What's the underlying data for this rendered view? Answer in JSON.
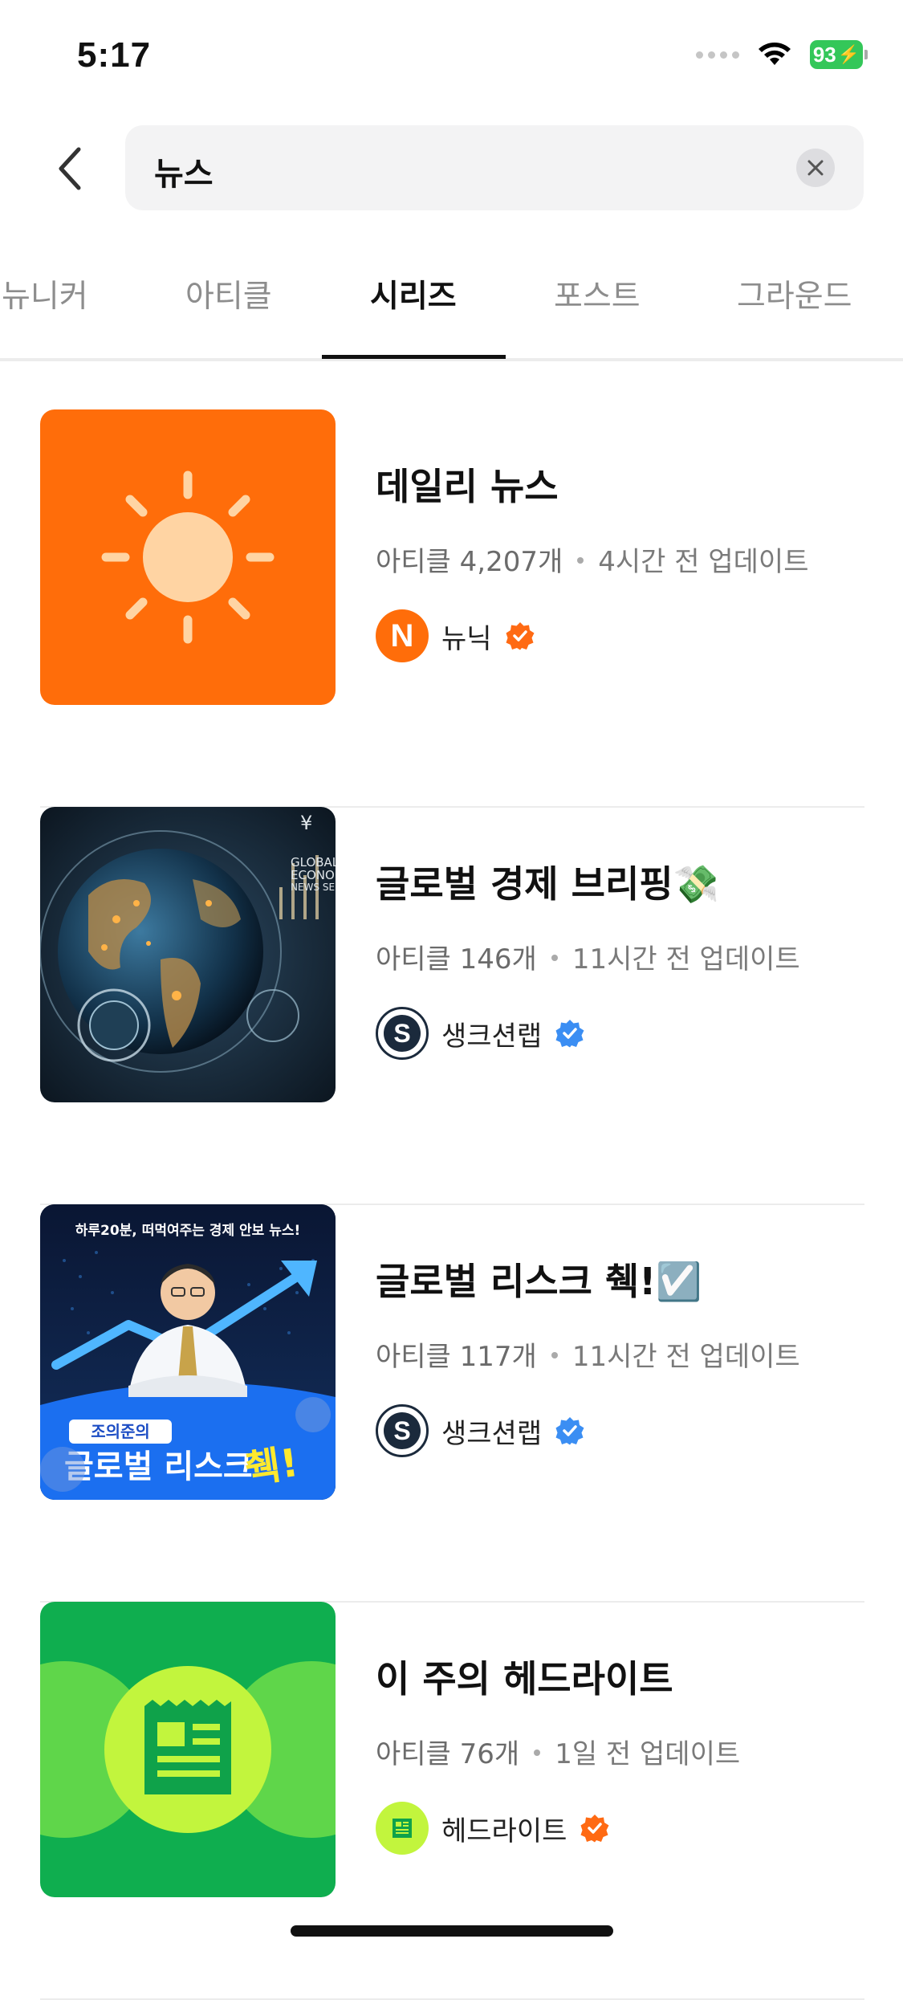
{
  "status": {
    "time": "5:17",
    "battery": "93"
  },
  "search": {
    "query": "뉴스"
  },
  "tabs": [
    {
      "label": "뉴니커"
    },
    {
      "label": "아티클"
    },
    {
      "label": "시리즈"
    },
    {
      "label": "포스트"
    },
    {
      "label": "그라운드"
    }
  ],
  "active_tab": "시리즈",
  "series": [
    {
      "title": "데일리 뉴스",
      "count": "아티클 4,207개",
      "updated": "4시간 전 업데이트",
      "author": "뉴닉",
      "badge_color": "#ff6a13",
      "thumb": "sun-icon"
    },
    {
      "title": "글로벌 경제 브리핑💸",
      "count": "아티클 146개",
      "updated": "11시간 전 업데이트",
      "author": "생크션랩",
      "badge_color": "#3b8ef3",
      "thumb": "globe-image",
      "thumb_text": [
        "GLOBAL",
        "ECONOMY",
        "NEWS SER"
      ]
    },
    {
      "title": "글로벌 리스크 췍!☑️",
      "count": "아티클 117개",
      "updated": "11시간 전 업데이트",
      "author": "생크션랩",
      "badge_color": "#3b8ef3",
      "thumb": "presenter-image",
      "thumb_top": "하루20분, 떠먹여주는 경제 안보 뉴스!",
      "thumb_name": "조의준의",
      "thumb_title": "글로벌 리스크",
      "thumb_title_accent": "췍!"
    },
    {
      "title": "이 주의 헤드라이트",
      "count": "아티클 76개",
      "updated": "1일 전 업데이트",
      "author": "헤드라이트",
      "badge_color": "#ff6a13",
      "thumb": "newspaper-icon"
    }
  ],
  "colors": {
    "accent_orange": "#ff6d0a",
    "accent_green": "#0fae4f",
    "lime": "#c2f53d",
    "verified_blue": "#3b8ef3"
  }
}
